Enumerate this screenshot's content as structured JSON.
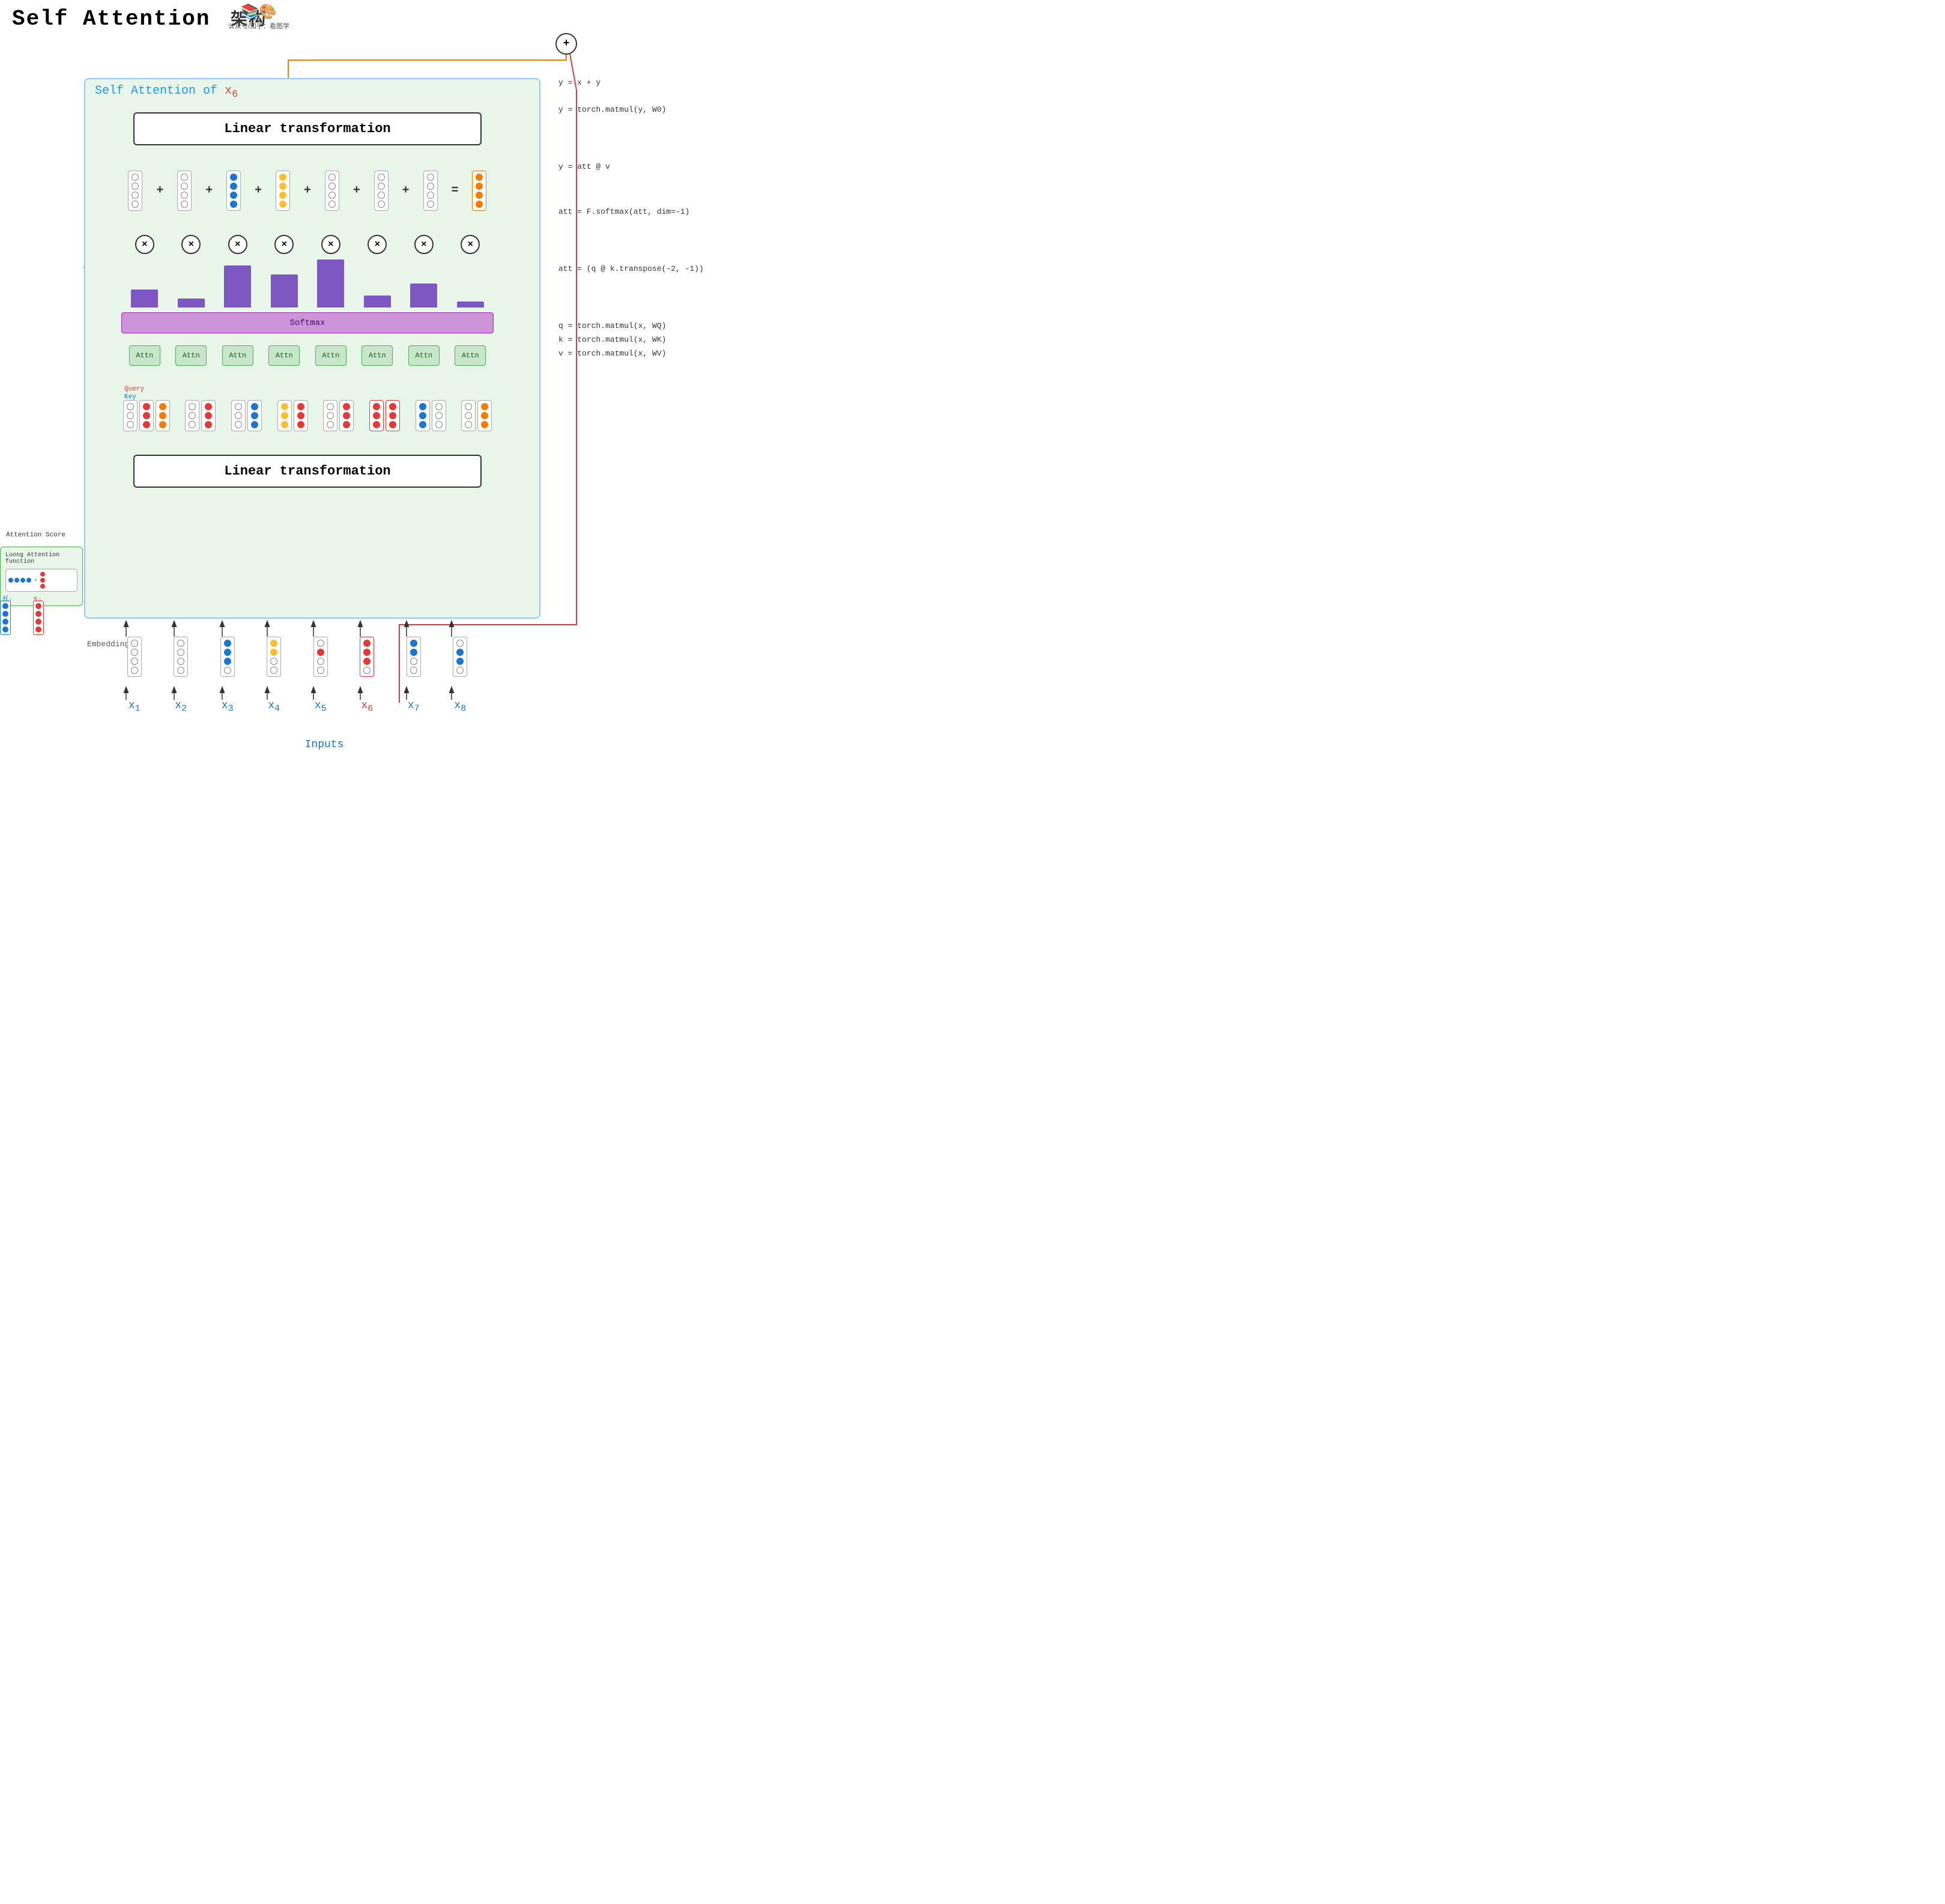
{
  "title": {
    "english": "Self  Attention",
    "chinese": "架构",
    "logo_text": "公众号/知乎：看图学"
  },
  "main_box": {
    "label": "Self Attention of",
    "subscript": "x₆"
  },
  "linear_top": {
    "label": "Linear transformation"
  },
  "linear_bottom": {
    "label": "Linear transformation"
  },
  "softmax": {
    "label": "Softmax"
  },
  "attn_boxes": {
    "label": "Attn",
    "count": 8
  },
  "bars": {
    "heights": [
      30,
      15,
      70,
      55,
      80,
      20,
      40,
      10
    ]
  },
  "equations": {
    "residual": "y = x + y",
    "linear_out": "y = torch.matmul(y, W0)",
    "att_v": "y = att @ v",
    "softmax_eq": "att = F.softmax(att, dim=-1)",
    "qk": "att = (q @ k.transpose(-2, -1))",
    "qkv": [
      "q = torch.matmul(x, WQ)",
      "k = torch.matmul(x, WK)",
      "v = torch.matmul(x, WV)"
    ]
  },
  "inputs": {
    "labels": [
      "x₁",
      "x₂",
      "x₃",
      "x₄",
      "x₅",
      "x₆",
      "x₇",
      "x₈"
    ],
    "highlighted": 5,
    "title": "Inputs"
  },
  "embedding_label": "Embedding",
  "luong": {
    "title": "Luong Attention function",
    "attention_score": "Attention Score"
  },
  "labels": {
    "hj": "hⱼ",
    "si": "sᵢ",
    "key": "Key",
    "query": "Query"
  }
}
